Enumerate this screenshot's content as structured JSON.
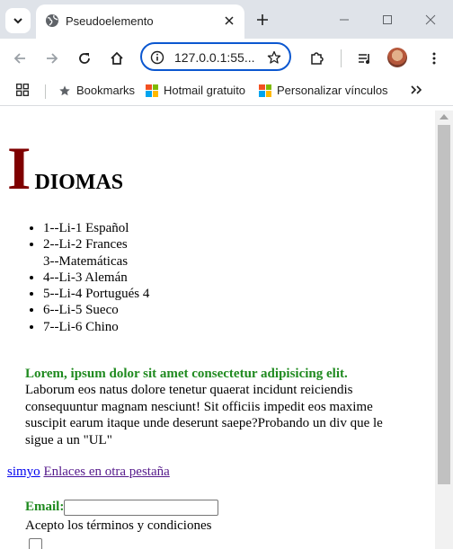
{
  "browser": {
    "tab": {
      "title": "Pseudoelemento",
      "favicon": "globe-icon"
    },
    "address": {
      "url": "127.0.0.1:55..."
    },
    "bookmarks": [
      {
        "label": "Bookmarks",
        "icon": "star-icon"
      },
      {
        "label": "Hotmail gratuito",
        "icon": "microsoft-logo-icon"
      },
      {
        "label": "Personalizar vínculos",
        "icon": "microsoft-logo-icon"
      }
    ],
    "accent": "#0b57d0"
  },
  "page": {
    "heading": {
      "drop_cap": "I",
      "rest": "DIOMAS",
      "drop_cap_color": "#7f0000"
    },
    "list_items": [
      "1--Li-1 Español",
      "2--Li-2 Frances",
      "3--Matemáticas",
      "4--Li-3 Alemán",
      "5--Li-4 Portugués 4",
      "6--Li-5 Sueco",
      "7--Li-6 Chino"
    ],
    "paragraph": {
      "strong": "Lorem, ipsum dolor sit amet consectetur adipisicing elit.",
      "body": "Laborum eos natus dolore tenetur quaerat incidunt reiciendis consequuntur magnam nesciunt! Sit officiis impedit eos maxime suscipit earum itaque unde deserunt saepe?Probando un div que le sigue a un \"UL\""
    },
    "links": {
      "first": "simyo",
      "second": "Enlaces en otra pestaña"
    },
    "form": {
      "email_label": "Email:",
      "email_value": "",
      "terms_label": "Acepto los términos y condiciones"
    },
    "text_green": "#1f8a1f"
  }
}
